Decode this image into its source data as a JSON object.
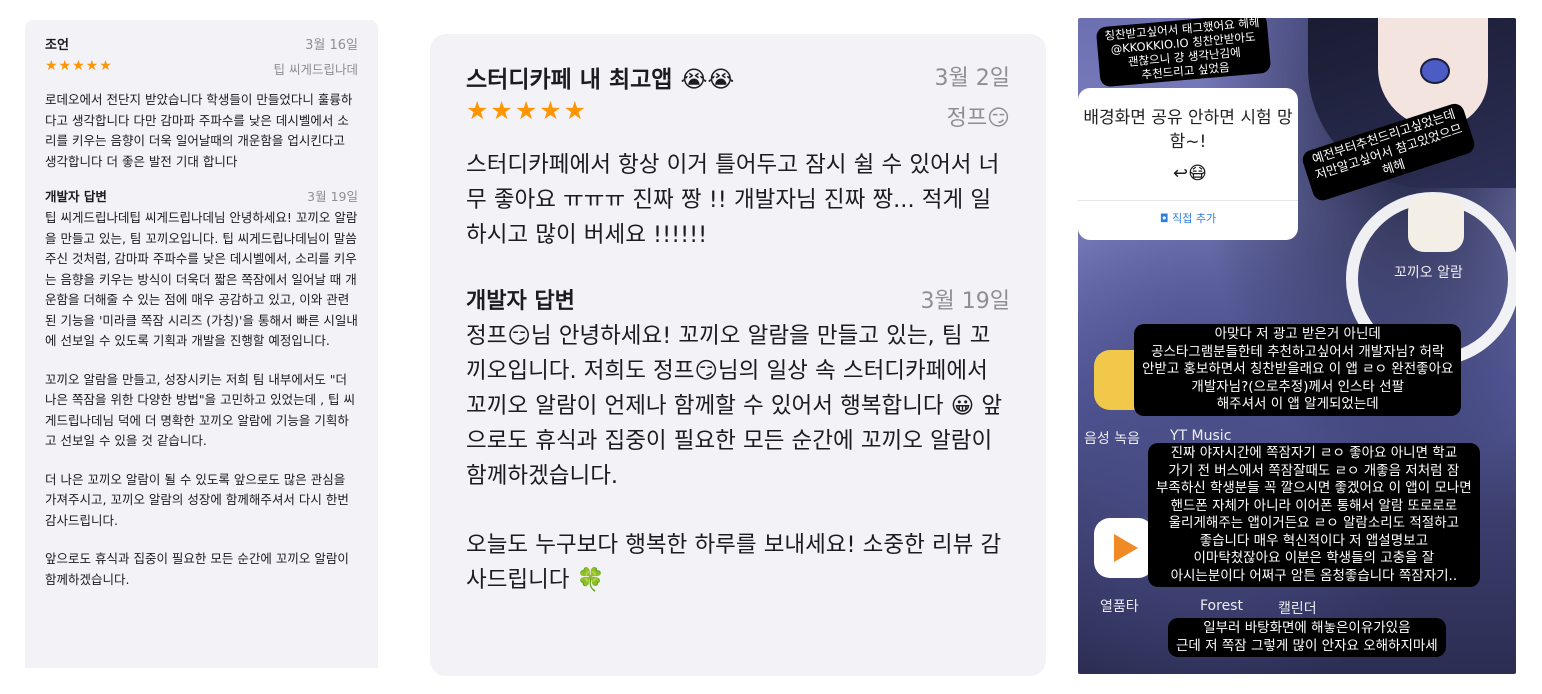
{
  "left_review": {
    "title": "조언",
    "date": "3월 16일",
    "stars": "★★★★★",
    "nickname": "팁 씨게드립나데",
    "body": "로데오에서 전단지 받았습니다 학생들이 만들었다니 훌륭하다고 생각합니다 다만 감마파 주파수를 낮은 데시벨에서 소리를 키우는 음향이 더욱 일어날때의 개운함을 업시킨다고 생각합니다 더 좋은 발전 기대 합니다",
    "dev_label": "개발자 답변",
    "dev_date": "3월 19일",
    "dev_paragraphs": [
      "팁 씨게드립나데팁 씨게드립나데님 안녕하세요! 꼬끼오 알람을 만들고 있는, 팀 꼬끼오입니다. 팁 씨게드립나데님이 말씀 주신 것처럼, 감마파 주파수를 낮은 데시벨에서, 소리를 키우는 음향을 키우는 방식이 더욱더 짧은 쪽잠에서 일어날 때 개운함을 더해줄 수 있는 점에 매우 공감하고 있고, 이와 관련된 기능을 '미라클 쪽잠 시리즈 (가칭)'을 통해서 빠른 시일내에 선보일 수 있도록 기획과 개발을 진행할 예정입니다.",
      "꼬끼오 알람을 만들고, 성장시키는 저희 팀 내부에서도 \"더 나은 쪽잠을 위한 다양한 방법\"을 고민하고 있었는데 , 팁 씨게드립나데님 덕에 더 명확한 꼬끼오 알람에 기능을 기획하고 선보일 수 있을 것 같습니다.",
      "더 나은 꼬끼오 알람이 될 수 있도록 앞으로도 많은 관심을 가져주시고, 꼬끼오 알람의 성장에 함께해주셔서 다시 한번 감사드립니다.",
      "앞으로도 휴식과 집중이 필요한 모든 순간에 꼬끼오 알람이 함께하겠습니다."
    ]
  },
  "middle_review": {
    "title": "스터디카페 내 최고앱 😭😭",
    "date": "3월 2일",
    "stars": "★★★★★",
    "nickname": "정프😏",
    "body": "스터디카페에서 항상 이거 틀어두고 잠시 쉴 수 있어서 너무 좋아요 ㅠㅠㅠ 진짜 짱 !! 개발자님 진짜 짱... 적게 일하시고 많이 버세요 !!!!!!",
    "dev_label": "개발자 답변",
    "dev_date": "3월 19일",
    "dev_paragraphs": [
      "정프😏님 안녕하세요! 꼬끼오 알람을 만들고 있는, 팀 꼬끼오입니다. 저희도 정프😏님의 일상 속 스터디카페에서 꼬끼오 알람이 언제나 함께할 수 있어서 행복합니다 😀 앞으로도 휴식과 집중이 필요한 모든 순간에 꼬끼오 알람이 함께하겠습니다.",
      "오늘도 누구보다 행복한 하루를 보내세요! 소중한 리뷰 감사드립니다 🍀"
    ]
  },
  "story": {
    "widget_text": "배경화면 공유 안하면 시험 망함~!",
    "widget_emoji": "↩😷",
    "widget_button": "직접 추가",
    "app_labels": [
      "꼬끼오 알람",
      "음성 녹음",
      "YT Music",
      "열품타",
      "Forest",
      "캘린더"
    ],
    "captions": [
      "칭찬받고싶어서 태그했어요 헤헤\n@KKOKKIO.IO 칭찬안받아도\n괜찮으니 걍 생각난김에\n추천드리고 싶었음",
      "예전부터추천드리고싶었는데\n저만알고싶어서 참고있었으므\n헤헤",
      "아맞다 저 광고 받은거 아닌데\n공스타그램분들한테 추천하고싶어서 개발자님? 허락\n안받고 홍보하면서 칭찬받을래요 이 앱 ㄹㅇ 완전좋아요\n개발자님?(으로추정)께서 인스타 선팔\n해주셔서 이 앱 알게되었는데",
      "진짜 야자시간에 쪽잠자기 ㄹㅇ 좋아요 아니면 학교\n가기 전 버스에서 쪽잠잘때도 ㄹㅇ 개좋음 저처럼 잠\n부족하신 학생분들 꼭 깔으시면 좋겠어요 이 앱이 모나면\n핸드폰 자체가 아니라 이어폰 통해서 알람 또로로로\n울리게해주는 앱이거든요 ㄹㅇ 알람소리도 적절하고\n좋습니다 매우 혁신적이다 저 앱설명보고\n이마탁쳤잖아요 이분은 학생들의 고충을 잘\n아시는분이다 어쩌구 암튼 옴청좋습니다 쪽잠자기..",
      "일부러 바탕화면에 해놓은이유가있음\n근데 저 쪽잠 그렇게 많이 안자요 오해하지마세"
    ],
    "colors": {
      "accent": "#ff9500",
      "link": "#2f7fe0"
    }
  }
}
